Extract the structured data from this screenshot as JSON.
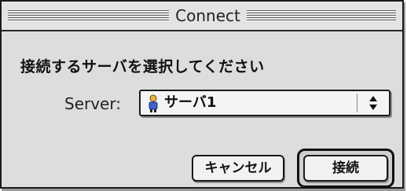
{
  "window": {
    "title": "Connect"
  },
  "dialog": {
    "prompt": "接続するサーバを選択してください",
    "server_label": "Server:",
    "server_value": "サーバ1",
    "server_icon": "user-icon"
  },
  "buttons": {
    "cancel_label": "キャンセル",
    "connect_label": "接続"
  }
}
